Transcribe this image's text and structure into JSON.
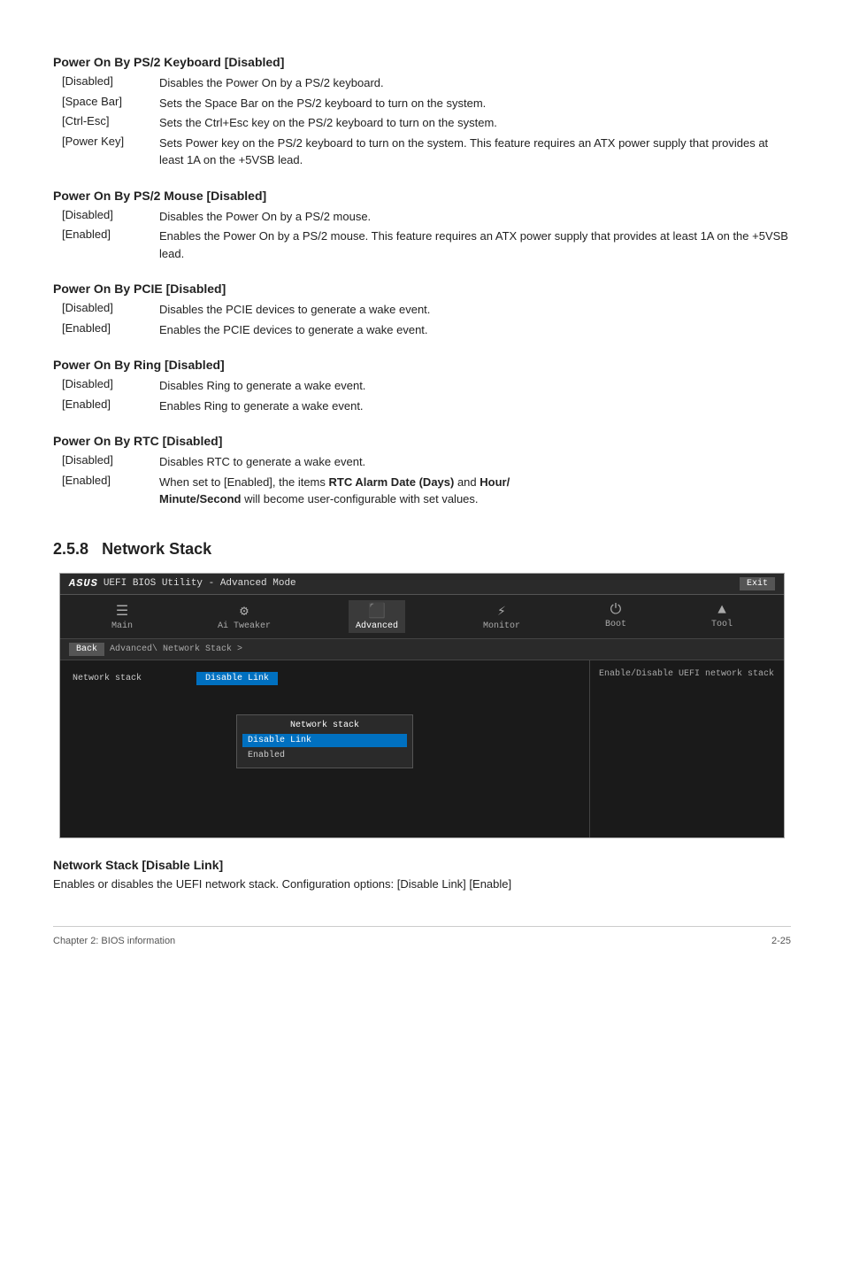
{
  "page": {
    "sections": [
      {
        "id": "ps2-keyboard",
        "title": "Power On By PS/2 Keyboard [Disabled]",
        "items": [
          {
            "term": "[Disabled]",
            "desc": "Disables the Power On by a PS/2 keyboard."
          },
          {
            "term": "[Space Bar]",
            "desc": "Sets the Space Bar on the PS/2 keyboard to turn on the system."
          },
          {
            "term": "[Ctrl-Esc]",
            "desc": "Sets the Ctrl+Esc key on the PS/2 keyboard to turn on the system."
          },
          {
            "term": "[Power Key]",
            "desc": "Sets Power key on the PS/2 keyboard to turn on the system. This feature requires an ATX power supply that provides at least 1A on the +5VSB lead."
          }
        ]
      },
      {
        "id": "ps2-mouse",
        "title": "Power On By PS/2 Mouse [Disabled]",
        "items": [
          {
            "term": "[Disabled]",
            "desc": "Disables the Power On by a PS/2 mouse."
          },
          {
            "term": "[Enabled]",
            "desc": "Enables the Power On by a PS/2 mouse. This feature requires an ATX power supply that provides at least 1A on the +5VSB lead."
          }
        ]
      },
      {
        "id": "pcie",
        "title": "Power On By PCIE [Disabled]",
        "items": [
          {
            "term": "[Disabled]",
            "desc": "Disables the PCIE devices to generate a wake event."
          },
          {
            "term": "[Enabled]",
            "desc": "Enables the PCIE devices to generate a wake event."
          }
        ]
      },
      {
        "id": "ring",
        "title": "Power On By Ring [Disabled]",
        "items": [
          {
            "term": "[Disabled]",
            "desc": "Disables Ring to generate a wake event."
          },
          {
            "term": "[Enabled]",
            "desc": "Enables Ring to generate a wake event."
          }
        ]
      },
      {
        "id": "rtc",
        "title": "Power On By RTC [Disabled]",
        "items": [
          {
            "term": "[Disabled]",
            "desc": "Disables RTC to generate a wake event."
          },
          {
            "term": "[Enabled]",
            "desc": "When set to [Enabled], the items RTC Alarm Date (Days) and Hour/Minute/Second will become user-configurable with set values.",
            "bold_parts": [
              "RTC Alarm Date (Days)",
              "Hour/",
              "Minute/Second"
            ]
          }
        ]
      }
    ],
    "section_number": "2.5.8",
    "section_subtitle": "Network Stack",
    "bios": {
      "titlebar": {
        "logo": "ASUS",
        "title": "UEFI BIOS Utility - Advanced Mode",
        "exit_label": "Exit"
      },
      "nav_items": [
        {
          "id": "main",
          "icon": "☰",
          "label": "Main"
        },
        {
          "id": "ai-tweaker",
          "icon": "⚙",
          "label": "Ai Tweaker"
        },
        {
          "id": "advanced",
          "icon": "⬛",
          "label": "Advanced",
          "active": true
        },
        {
          "id": "monitor",
          "icon": "⚡",
          "label": "Monitor"
        },
        {
          "id": "boot",
          "icon": "⏻",
          "label": "Boot"
        },
        {
          "id": "tool",
          "icon": "▲",
          "label": "Tool"
        }
      ],
      "breadcrumb": {
        "back_label": "Back",
        "path": "Advanced\\  Network Stack >"
      },
      "rows": [
        {
          "label": "Network stack",
          "value": "Disable Link"
        }
      ],
      "right_help": "Enable/Disable UEFI network stack",
      "popup": {
        "title": "Network stack",
        "selected": "Disable Link",
        "options": [
          "Enabled"
        ]
      }
    },
    "network_stack_section": {
      "title": "Network Stack [Disable Link]",
      "desc": "Enables or disables the UEFI network stack. Configuration options: [Disable Link] [Enable]"
    },
    "footer": {
      "left": "Chapter 2: BIOS information",
      "right": "2-25"
    }
  }
}
